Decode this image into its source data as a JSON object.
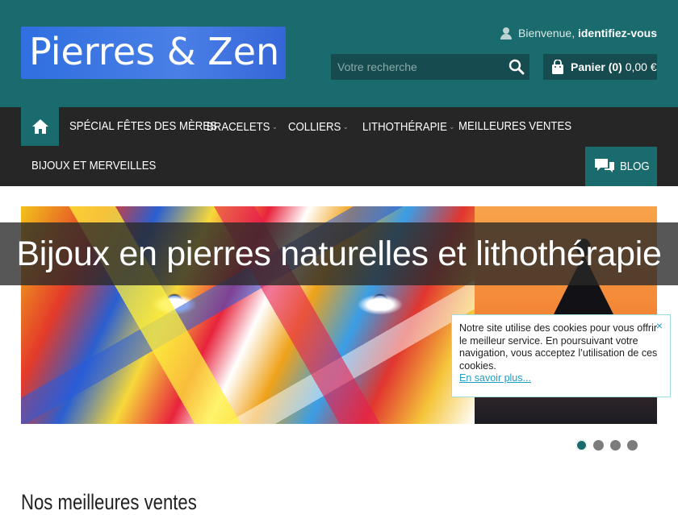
{
  "header": {
    "logo_text": "Pierres & Zen",
    "welcome_prefix": "Bienvenue,",
    "login_link": "identifiez-vous",
    "search_placeholder": "Votre recherche",
    "cart_label": "Panier (0)",
    "cart_total": "0,00 €",
    "colors": {
      "brand": "#1a6b6d",
      "nav": "#262626",
      "logo_bg": "#3a74e0"
    }
  },
  "nav": {
    "items": [
      {
        "label": "Spécial Fêtes des Mères",
        "has_dropdown": false
      },
      {
        "label": "Bracelets",
        "has_dropdown": true
      },
      {
        "label": "Colliers",
        "has_dropdown": true
      },
      {
        "label": "Lithothérapie",
        "has_dropdown": true
      },
      {
        "label": "Meilleures ventes",
        "has_dropdown": false
      },
      {
        "label": "Bijoux et merveilles",
        "has_dropdown": false
      }
    ],
    "blog_label": "Blog",
    "icons": {
      "home": "home-icon",
      "blog": "chat-bubbles-icon",
      "dropdown": "chevron-down-icon"
    }
  },
  "banner": {
    "title": "Bijoux en pierres naturelles et lithothérapie"
  },
  "cookie": {
    "message": "Notre site utilise des cookies pour vous offrir le meilleur service. En poursuivant votre navigation, vous acceptez l’utilisation de ces cookies.",
    "more_link": "En savoir plus...",
    "close_label": "×"
  },
  "slider": {
    "slide_count": 4,
    "active_index": 0
  },
  "sections": {
    "best_sellers_title": "Nos meilleures ventes"
  }
}
